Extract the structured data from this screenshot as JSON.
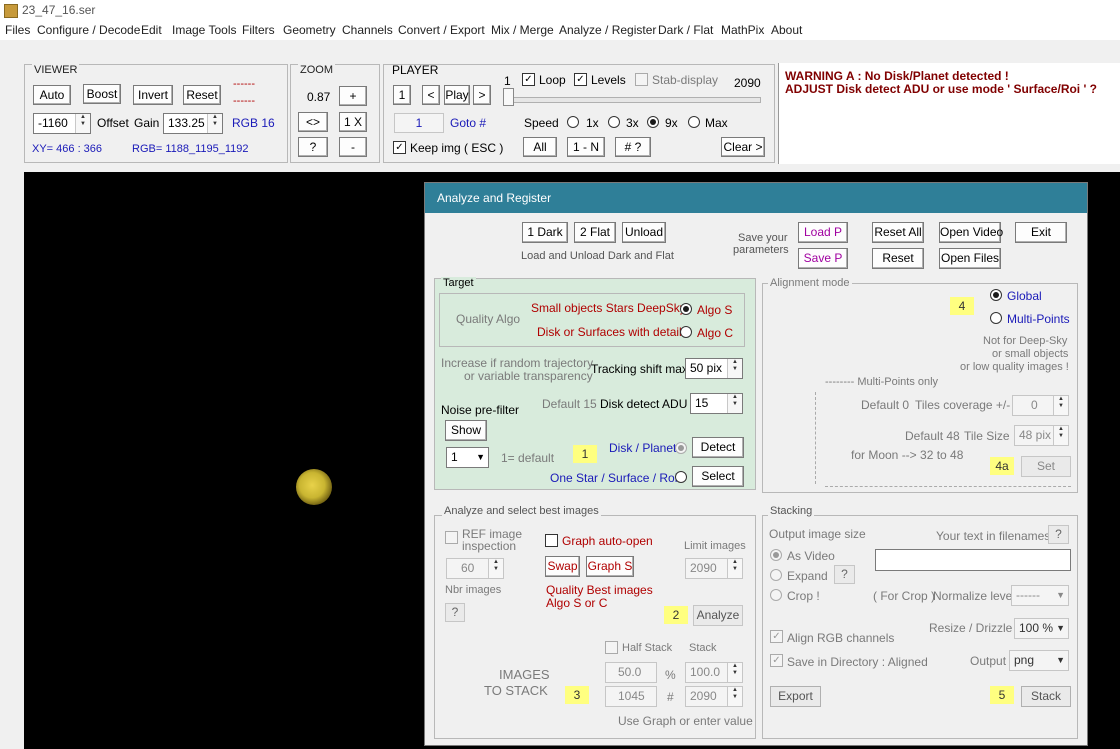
{
  "window_title": "23_47_16.ser",
  "menu": [
    "Files",
    "Configure / Decode",
    "Edit",
    "Image Tools",
    "Filters",
    "Geometry",
    "Channels",
    "Convert / Export",
    "Mix / Merge",
    "Analyze / Register",
    "Dark / Flat",
    "MathPix",
    "About"
  ],
  "viewer": {
    "label": "VIEWER",
    "auto": "Auto",
    "boost": "Boost",
    "invert": "Invert",
    "reset": "Reset",
    "dash1": "------",
    "dash2": "------",
    "offset_value": "-1160",
    "offset_label": "Offset",
    "gain_label": "Gain",
    "gain_value": "133.25",
    "rgb_mode": "RGB 16",
    "xy": "XY=  466 : 366",
    "rgb": "RGB=  1188_1195_1192"
  },
  "zoom": {
    "label": "ZOOM",
    "value": "0.87",
    "plus": "+",
    "fit": "<>",
    "onex": "1 X",
    "help": "?",
    "minus": "-"
  },
  "player": {
    "label": "PLAYER",
    "frame_start": "1",
    "loop": "Loop",
    "levels": "Levels",
    "stab": "Stab-display",
    "frame_end": "2090",
    "btn1": "1",
    "prev": "<",
    "play": "Play",
    "next": ">",
    "current": "1",
    "goto": "Goto #",
    "speed": "Speed",
    "s1": "1x",
    "s3": "3x",
    "s9": "9x",
    "smax": "Max",
    "keep": "Keep img ( ESC )",
    "all": "All",
    "one_n": "1 - N",
    "hash": "# ?",
    "clear": "Clear >",
    "slider_pos": 0.0
  },
  "warning": {
    "line1": "WARNING A    :   No Disk/Planet detected  !",
    "line2": "ADJUST  Disk detect ADU     or     use mode  ' Surface/Roi ' ?"
  },
  "dialog": {
    "title": "Analyze and Register",
    "dark": "1 Dark",
    "flat": "2 Flat",
    "unload": "Unload",
    "dark_note": "Load and Unload Dark and Flat",
    "save_note1": "Save your",
    "save_note2": "parameters",
    "load_p": "Load P",
    "save_p": "Save P",
    "reset_all": "Reset All",
    "reset": "Reset",
    "open_video": "Open Video",
    "open_files": "Open Files",
    "exit": "Exit",
    "target": {
      "label": "Target",
      "quality_algo": "Quality Algo",
      "small": "Small objects  Stars  DeepSky",
      "algo_s": "Algo S",
      "disk": "Disk or Surfaces with details",
      "algo_c": "Algo C",
      "inc1": "Increase if random trajectory",
      "inc2": "or variable transparency",
      "track_label": "Tracking shift max",
      "track_value": "50 pix",
      "noise": "Noise pre-filter",
      "show": "Show",
      "default15": "Default 15",
      "adu_label": "Disk detect ADU",
      "adu_value": "15",
      "filter_value": "1",
      "one_default": "1= default",
      "step": "1",
      "disk_planet": "Disk / Planet",
      "detect": "Detect",
      "one_star": "One Star / Surface /  Roi",
      "select": "Select"
    },
    "align": {
      "label": "Alignment mode",
      "step": "4",
      "global": "Global",
      "multi": "Multi-Points",
      "note1": "Not for Deep-Sky",
      "note2": "or small objects",
      "note3": "or low quality images !",
      "mp_only": "-------- Multi-Points only",
      "default0": "Default 0",
      "tiles_cov": "Tiles coverage +/-",
      "tiles_cov_val": "0",
      "default48": "Default 48",
      "tile_size": "Tile Size",
      "tile_size_val": "48 pix",
      "moon": "for Moon --> 32 to 48",
      "step4a": "4a",
      "set": "Set"
    },
    "analyze": {
      "label": "Analyze and select best images",
      "ref1": "REF image",
      "ref2": "inspection",
      "graph_auto": "Graph auto-open",
      "limit": "Limit images",
      "nbr_val": "60",
      "swap": "Swap",
      "graph_s": "Graph S",
      "limit_val": "2090",
      "nbr_label": "Nbr images",
      "q1": "Quality Best images",
      "q2": "Algo S or C",
      "help": "?",
      "step": "2",
      "analyze": "Analyze",
      "half": "Half Stack",
      "stack_lbl": "Stack",
      "img1": "IMAGES",
      "img2": "TO STACK",
      "pct1": "50.0",
      "pct_sign": "%",
      "pct2": "100.0",
      "n1": "1045",
      "hash": "#",
      "n2": "2090",
      "step3": "3",
      "use": "Use Graph or enter value"
    },
    "stacking": {
      "label": "Stacking",
      "out_size": "Output  image size",
      "your_text": "Your text in filenames",
      "help": "?",
      "as_video": "As Video",
      "expand": "Expand",
      "crop": "Crop !",
      "for_crop": "( For Crop )",
      "norm": "Normalize level",
      "norm_val": "------",
      "resize": "Resize /  Drizzle",
      "resize_val": "100 %",
      "align_rgb": "Align RGB channels",
      "save_dir": "Save in Directory : Aligned",
      "output": "Output",
      "output_val": "png",
      "export": "Export",
      "step": "5",
      "stack": "Stack"
    }
  }
}
